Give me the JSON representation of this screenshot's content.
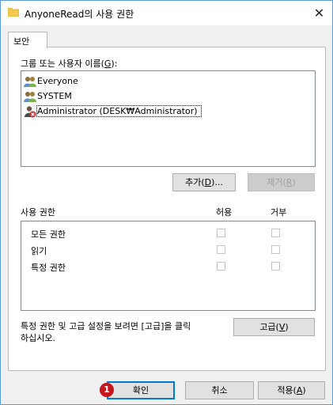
{
  "window": {
    "title": "AnyoneRead의 사용 권한",
    "close_glyph": "✕",
    "icon": "folder-icon"
  },
  "tab": {
    "label": "보안"
  },
  "groups": {
    "label_prefix": "그룹 또는 사용자 이름(",
    "label_key": "G",
    "label_suffix": "):",
    "items": [
      {
        "name": "Everyone",
        "icon": "users-group-icon",
        "selected": false
      },
      {
        "name": "SYSTEM",
        "icon": "users-group-icon",
        "selected": false
      },
      {
        "name": "Administrator (DESK₩Administrator)",
        "icon": "user-error-icon",
        "selected": true
      }
    ]
  },
  "buttons": {
    "add_prefix": "추가(",
    "add_key": "D",
    "add_suffix": ")...",
    "remove_prefix": "제거(",
    "remove_key": "R",
    "remove_suffix": ")",
    "advanced_prefix": "고급(",
    "advanced_key": "V",
    "advanced_suffix": ")",
    "ok": "확인",
    "cancel": "취소",
    "apply_prefix": "적용(",
    "apply_key": "A",
    "apply_suffix": ")"
  },
  "permissions": {
    "header": "사용 권한",
    "allow": "허용",
    "deny": "거부",
    "rows": [
      {
        "name": "모든 권한",
        "allow": false,
        "deny": false
      },
      {
        "name": "읽기",
        "allow": false,
        "deny": false
      },
      {
        "name": "특정 권한",
        "allow": false,
        "deny": false
      }
    ]
  },
  "advanced_note_line1": "특정 권한 및 고급 설정을 보려면 [고급]을 클릭",
  "advanced_note_line2": "하십시오.",
  "annotation": {
    "badge": "1"
  },
  "colors": {
    "accent": "#0078d7",
    "badge": "#c4161c",
    "window_border": "#5b9bd5"
  }
}
